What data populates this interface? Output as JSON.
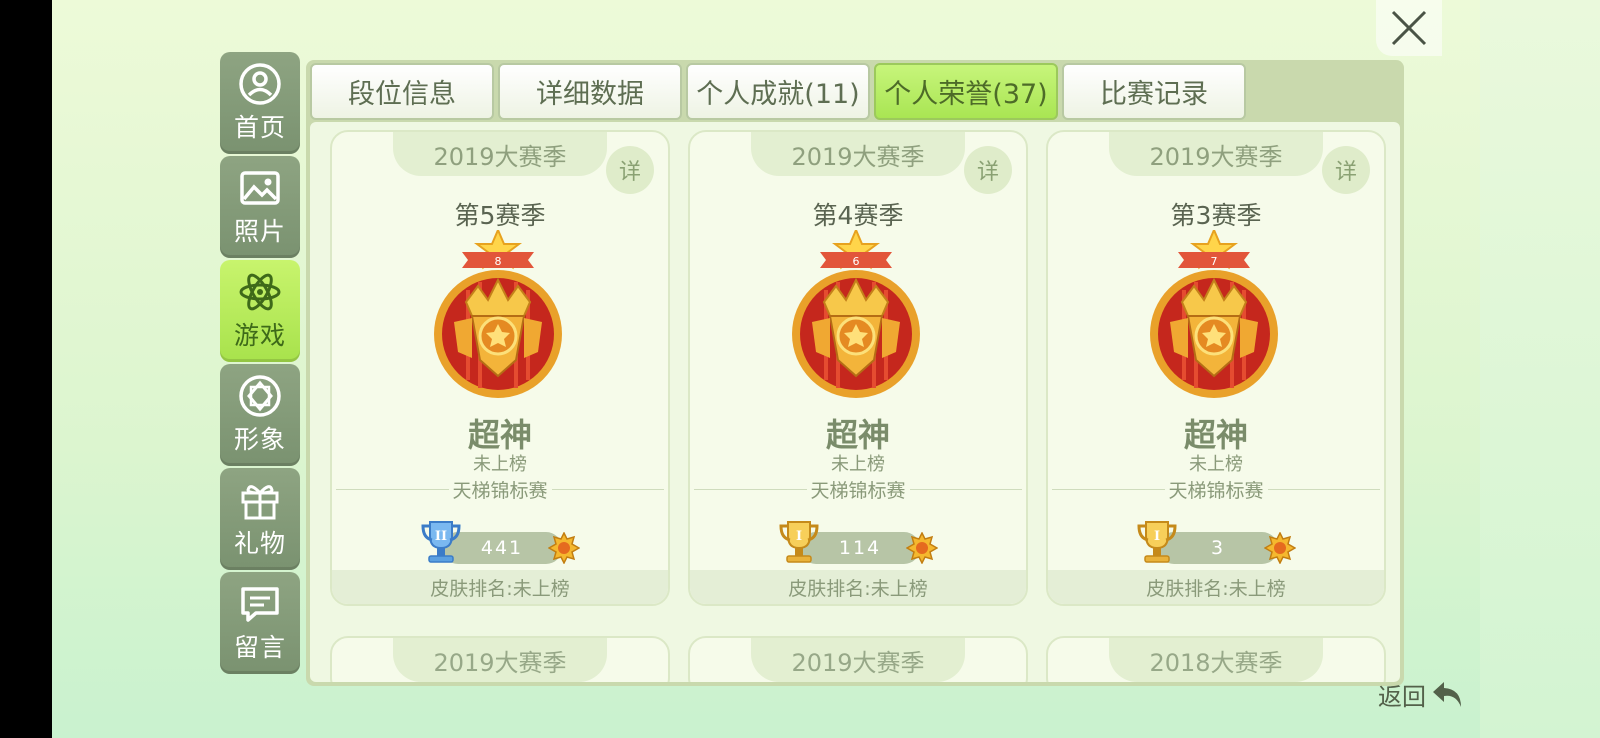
{
  "sidebar": {
    "items": [
      {
        "label": "首页",
        "icon": "user-icon"
      },
      {
        "label": "照片",
        "icon": "photo-icon"
      },
      {
        "label": "游戏",
        "icon": "atom-icon",
        "active": true
      },
      {
        "label": "形象",
        "icon": "diamond-icon"
      },
      {
        "label": "礼物",
        "icon": "gift-icon"
      },
      {
        "label": "留言",
        "icon": "message-icon"
      }
    ]
  },
  "tabs": [
    {
      "label": "段位信息"
    },
    {
      "label": "详细数据"
    },
    {
      "label": "个人成就(11)"
    },
    {
      "label": "个人荣誉(37)",
      "active": true
    },
    {
      "label": "比赛记录"
    }
  ],
  "cards": [
    {
      "season": "2019大赛季",
      "detail_label": "详",
      "sub_season": "第5赛季",
      "medal_number": "8",
      "rank_title": "超神",
      "rank_status": "未上榜",
      "tournament": "天梯锦标赛",
      "trophy": "blue",
      "score": "441",
      "skin_rank": "皮肤排名:未上榜"
    },
    {
      "season": "2019大赛季",
      "detail_label": "详",
      "sub_season": "第4赛季",
      "medal_number": "6",
      "rank_title": "超神",
      "rank_status": "未上榜",
      "tournament": "天梯锦标赛",
      "trophy": "gold",
      "score": "114",
      "skin_rank": "皮肤排名:未上榜"
    },
    {
      "season": "2019大赛季",
      "detail_label": "详",
      "sub_season": "第3赛季",
      "medal_number": "7",
      "rank_title": "超神",
      "rank_status": "未上榜",
      "tournament": "天梯锦标赛",
      "trophy": "gold",
      "score": "3",
      "skin_rank": "皮肤排名:未上榜"
    }
  ],
  "partial_cards": [
    {
      "season": "2019大赛季"
    },
    {
      "season": "2019大赛季"
    },
    {
      "season": "2018大赛季"
    }
  ],
  "back_label": "返回",
  "colors": {
    "accent": "#a8e24c",
    "sidebar": "#7a9270",
    "panel": "#c9d9ad"
  }
}
